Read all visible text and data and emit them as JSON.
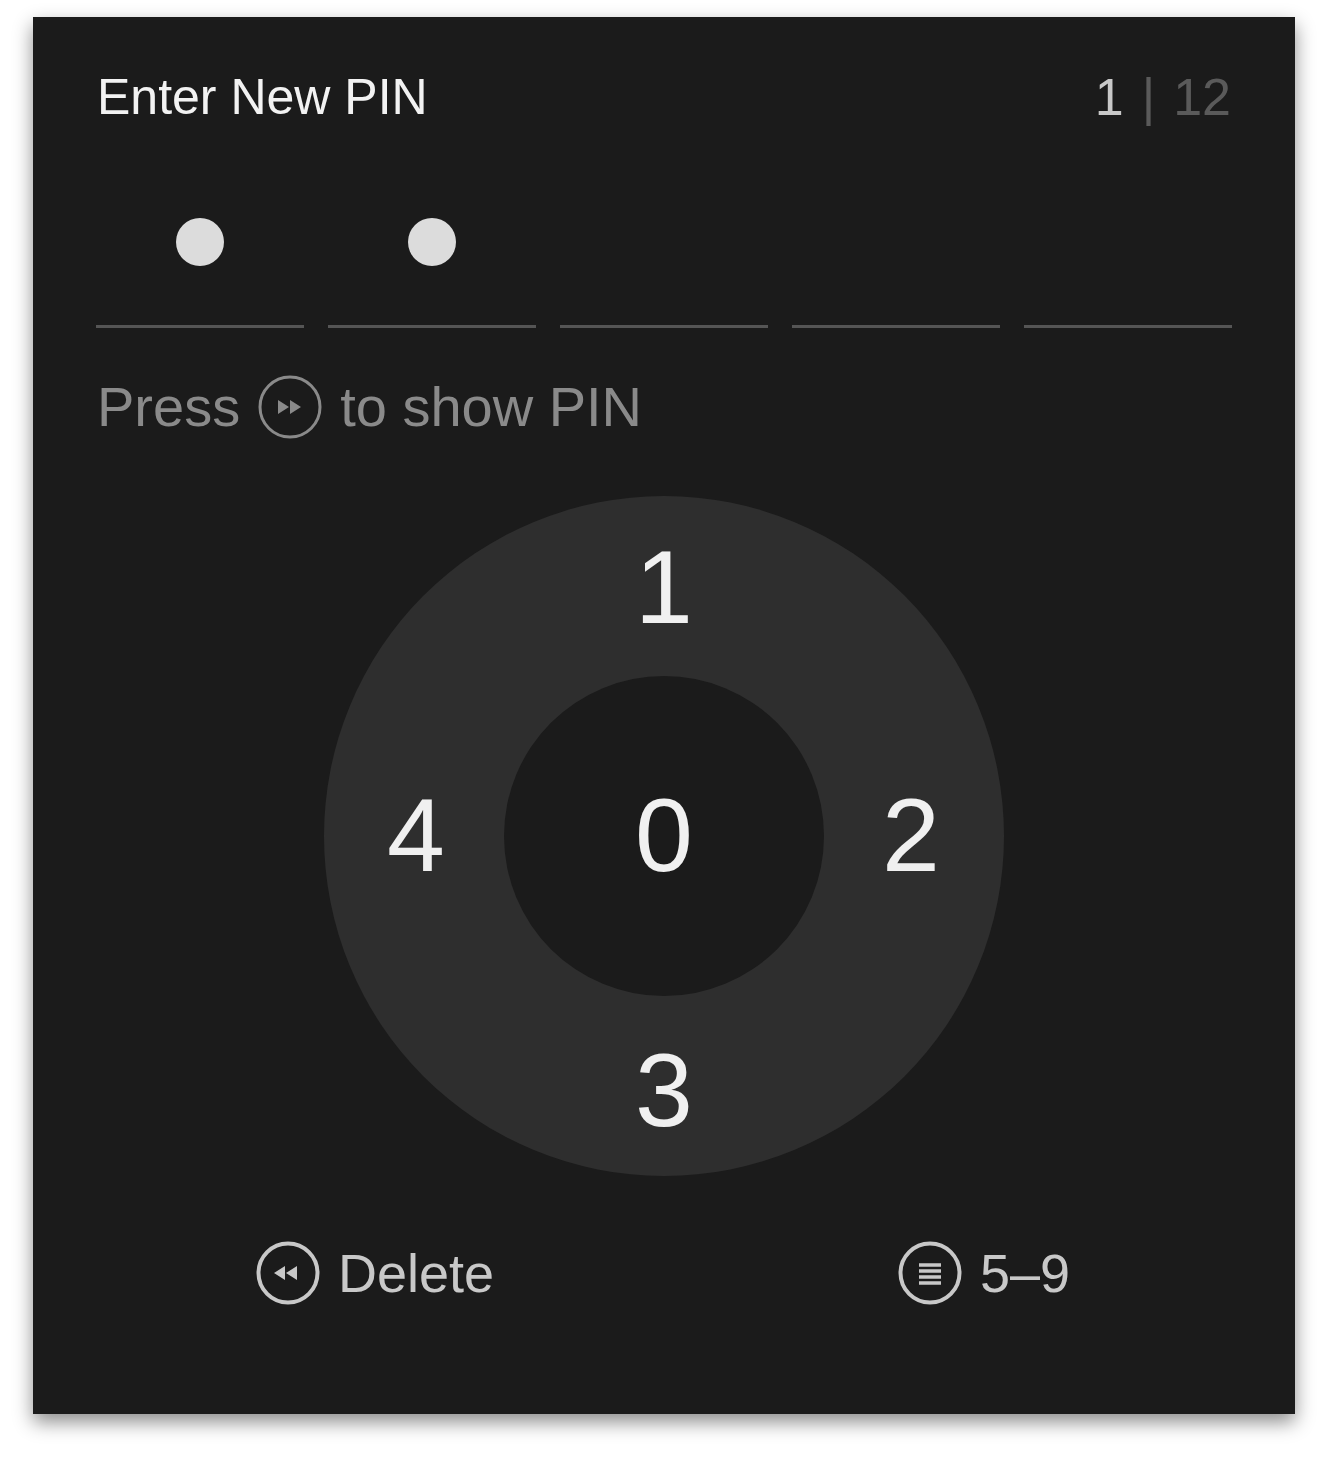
{
  "title": "Enter New PIN",
  "counter": {
    "current": "1",
    "separator": "|",
    "total": "12"
  },
  "pin_slots": [
    {
      "filled": true
    },
    {
      "filled": true
    },
    {
      "filled": false
    },
    {
      "filled": false
    },
    {
      "filled": false
    }
  ],
  "hint": {
    "before": "Press",
    "after": "to show PIN"
  },
  "dial_keys": [
    {
      "label": "1",
      "kind": "top"
    },
    {
      "label": "4",
      "kind": "left"
    },
    {
      "label": "0",
      "kind": "center"
    },
    {
      "label": "2",
      "kind": "right"
    },
    {
      "label": "3",
      "kind": "bottom"
    }
  ],
  "actions": [
    {
      "label": "Delete",
      "kind": "rewind"
    },
    {
      "label": "5–9",
      "kind": "menu"
    }
  ]
}
